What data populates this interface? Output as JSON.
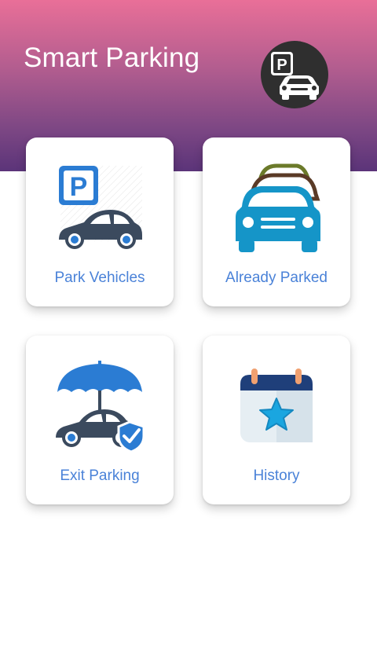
{
  "header": {
    "title": "Smart Parking",
    "logo_icon": "parking-car-logo-icon",
    "gradient_top": "#e96f98",
    "gradient_bottom": "#5b3479"
  },
  "menu": {
    "items": [
      {
        "label": "Park Vehicles",
        "icon": "park-vehicle-icon"
      },
      {
        "label": "Already Parked",
        "icon": "parked-cars-icon"
      },
      {
        "label": "Exit Parking",
        "icon": "insured-car-exit-icon"
      },
      {
        "label": "History",
        "icon": "calendar-star-icon"
      }
    ],
    "label_color": "#4a82d8"
  }
}
